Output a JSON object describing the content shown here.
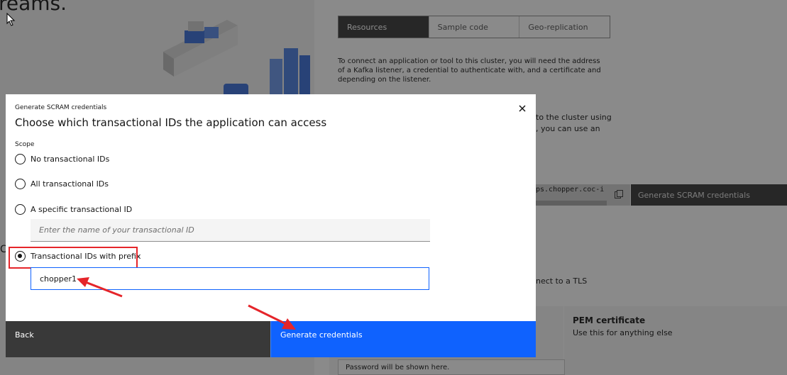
{
  "background": {
    "heading": "reams.",
    "tabs": [
      "Resources",
      "Sample code",
      "Geo-replication"
    ],
    "intro_text": "To connect an application or tool to this cluster, you will need the address of a Kafka listener, a credential to authenticate with, and a certificate and depending on the listener.",
    "fragment_1": "to the cluster using",
    "fragment_2": ", you can use an",
    "command_url": "ps.chopper.coc-i",
    "generate_scram_label": "Generate SCRAM credentials",
    "fragment_3": "nect to a TLS",
    "pem_title": "PEM certificate",
    "pem_desc": "Use this for anything else",
    "password_placeholder": "Password will be shown here.",
    "left_letter": "C"
  },
  "modal": {
    "label": "Generate SCRAM credentials",
    "title": "Choose which transactional IDs the application can access",
    "scope_label": "Scope",
    "options": [
      {
        "label": "No transactional IDs",
        "checked": false
      },
      {
        "label": "All transactional IDs",
        "checked": false
      },
      {
        "label": "A specific transactional ID",
        "checked": false
      },
      {
        "label": "Transactional IDs with prefix",
        "checked": true
      }
    ],
    "id_input_placeholder": "Enter the name of your transactional ID",
    "prefix_input_value": "chopper1",
    "back_label": "Back",
    "generate_label": "Generate credentials"
  },
  "colors": {
    "primary": "#0f62fe",
    "dark": "#393939",
    "annotation": "#e5252a"
  }
}
